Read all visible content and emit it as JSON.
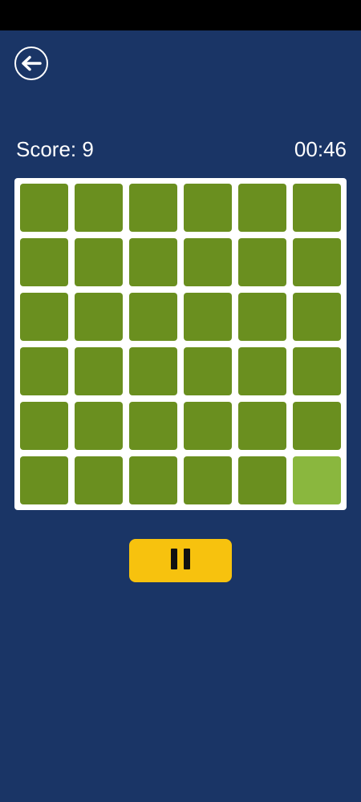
{
  "hud": {
    "score_label": "Score: 9",
    "timer": "00:46"
  },
  "icons": {
    "back": "arrow-left-icon",
    "pause": "pause-icon"
  },
  "board": {
    "rows": 6,
    "cols": 6,
    "tile_color": "#6a8f1f",
    "odd_tile_color": "#8ab73e",
    "odd_tile": {
      "row": 6,
      "col": 6
    }
  },
  "colors": {
    "background": "#1a3566",
    "board_background": "#ffffff",
    "pause_button": "#f7c20e"
  }
}
